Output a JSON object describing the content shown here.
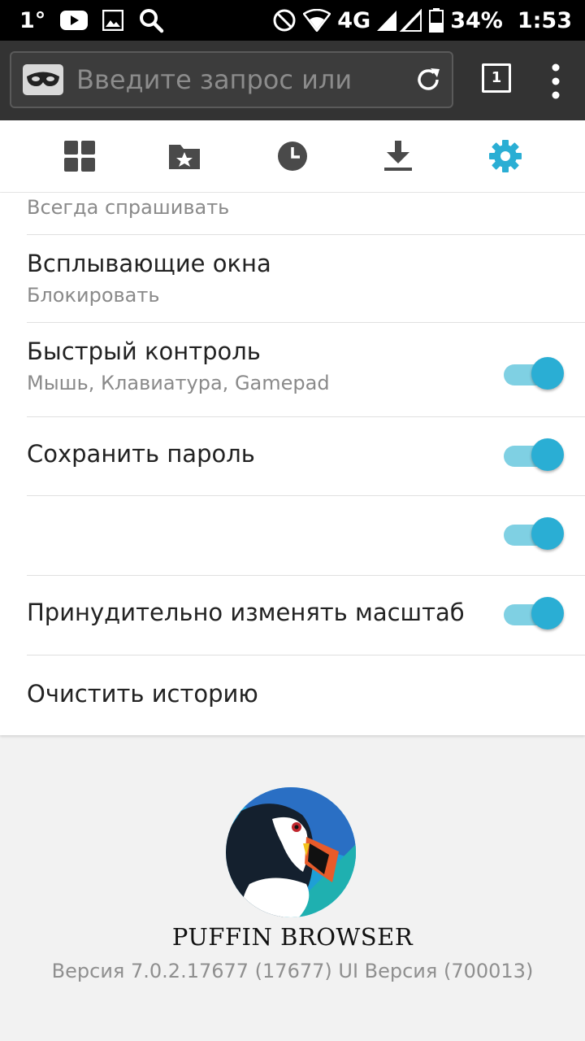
{
  "status_bar": {
    "temperature": "1°",
    "network": "4G",
    "battery": "34%",
    "time": "1:53",
    "icons": [
      "youtube-icon",
      "image-icon",
      "search-icon",
      "do-not-disturb-icon",
      "wifi-icon",
      "signal-icon",
      "battery-icon"
    ]
  },
  "toolbar": {
    "search_placeholder": "Введите запрос или",
    "tab_count": "1",
    "icons": [
      "incognito-mask-icon",
      "reload-icon",
      "more-vert-icon"
    ]
  },
  "nav": {
    "items": [
      "apps-grid-icon",
      "bookmarks-icon",
      "history-icon",
      "download-icon",
      "settings-gear-icon"
    ],
    "active": "settings-gear-icon",
    "active_color": "#2aaed4",
    "inactive_color": "#4a4a4a"
  },
  "settings": {
    "partial_subtitle": "Всегда спрашивать",
    "items": [
      {
        "title": "Всплывающие окна",
        "subtitle": "Блокировать"
      },
      {
        "title": "Быстрый контроль",
        "subtitle": "Мышь, Клавиатура, Gamepad",
        "toggle_on": true
      },
      {
        "title": "Сохранить пароль",
        "toggle_on": true
      },
      {
        "title": "",
        "toggle_on": true
      },
      {
        "title": "Принудительно изменять масштаб",
        "toggle_on": true
      },
      {
        "title": "Очистить историю"
      }
    ]
  },
  "footer": {
    "brand": "PUFFIN BROWSER",
    "version": "Версия 7.0.2.17677 (17677) UI Версия (700013)"
  }
}
